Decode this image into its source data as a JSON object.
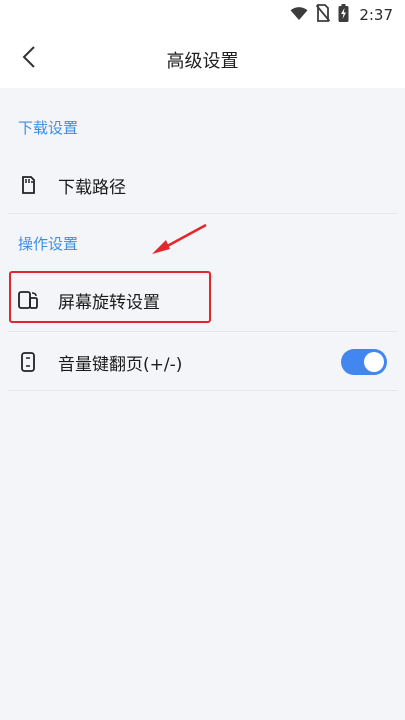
{
  "status_bar": {
    "time": "2:37",
    "icons": [
      "wifi-icon",
      "no-sim-icon",
      "battery-charging-icon"
    ]
  },
  "header": {
    "back_icon": "chevron-left-icon",
    "title": "高级设置"
  },
  "sections": [
    {
      "label": "下载设置",
      "items": [
        {
          "label": "下载路径",
          "icon": "sd-card-icon"
        }
      ]
    },
    {
      "label": "操作设置",
      "items": [
        {
          "label": "屏幕旋转设置",
          "icon": "screen-rotate-icon"
        },
        {
          "label": "音量键翻页(+/-)",
          "icon": "phone-volume-icon",
          "toggle_on": true
        }
      ]
    }
  ],
  "colors": {
    "accent": "#3b8ee8",
    "toggle_on": "#4286f0",
    "annotation": "#e3262b",
    "background": "#f4f5f9"
  }
}
